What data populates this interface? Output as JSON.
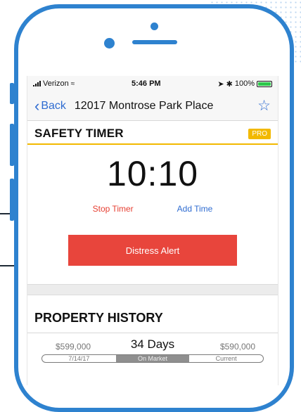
{
  "status_bar": {
    "carrier": "Verizon",
    "time": "5:46 PM",
    "battery": "100%",
    "battery_level": 1.0
  },
  "nav": {
    "back_label": "Back",
    "title": "12017 Montrose Park Place",
    "favorite_icon": "star-outline-icon"
  },
  "safety_timer": {
    "title": "SAFETY TIMER",
    "badge": "PRO",
    "time": "10:10",
    "stop_label": "Stop Timer",
    "add_label": "Add Time",
    "distress_label": "Distress Alert"
  },
  "property_history": {
    "title": "PROPERTY HISTORY",
    "start_price": "$599,000",
    "days": "34 Days",
    "end_price": "$590,000",
    "start_date": "7/14/17",
    "middle_label": "On Market",
    "end_label": "Current"
  },
  "colors": {
    "device_frame": "#2e82cf",
    "accent_yellow": "#f2b900",
    "link_blue": "#2f6cd1",
    "alert_red": "#e8453c"
  }
}
